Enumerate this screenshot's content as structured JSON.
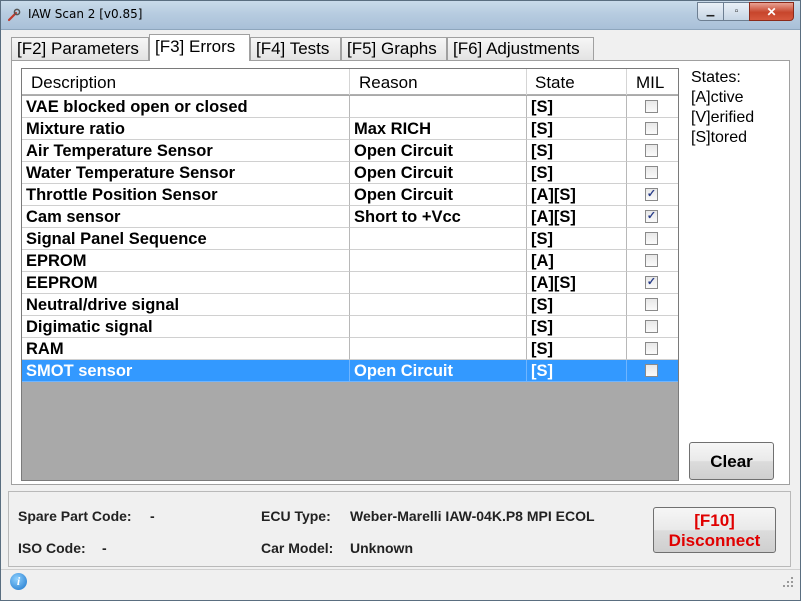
{
  "window": {
    "title": "IAW Scan 2 [v0.85]",
    "close_glyph": "✕",
    "min_glyph": "▁",
    "max_glyph": "▫"
  },
  "tabs": [
    {
      "label": "[F2] Parameters",
      "active": false
    },
    {
      "label": "[F3] Errors",
      "active": true
    },
    {
      "label": "[F4] Tests",
      "active": false
    },
    {
      "label": "[F5] Graphs",
      "active": false
    },
    {
      "label": "[F6] Adjustments",
      "active": false
    }
  ],
  "errors_table": {
    "columns": [
      "Description",
      "Reason",
      "State",
      "MIL"
    ],
    "rows": [
      {
        "description": "VAE blocked open or closed",
        "reason": "",
        "state": "[S]",
        "mil": false,
        "selected": false
      },
      {
        "description": "Mixture ratio",
        "reason": "Max RICH",
        "state": "[S]",
        "mil": false,
        "selected": false
      },
      {
        "description": "Air Temperature Sensor",
        "reason": "Open Circuit",
        "state": "[S]",
        "mil": false,
        "selected": false
      },
      {
        "description": "Water Temperature Sensor",
        "reason": "Open Circuit",
        "state": "[S]",
        "mil": false,
        "selected": false
      },
      {
        "description": "Throttle Position Sensor",
        "reason": "Open Circuit",
        "state": "[A][S]",
        "mil": true,
        "selected": false
      },
      {
        "description": "Cam sensor",
        "reason": "Short to +Vcc",
        "state": "[A][S]",
        "mil": true,
        "selected": false
      },
      {
        "description": "Signal Panel Sequence",
        "reason": "",
        "state": "[S]",
        "mil": false,
        "selected": false
      },
      {
        "description": "EPROM",
        "reason": "",
        "state": "[A]",
        "mil": false,
        "selected": false
      },
      {
        "description": "EEPROM",
        "reason": "",
        "state": "[A][S]",
        "mil": true,
        "selected": false
      },
      {
        "description": "Neutral/drive signal",
        "reason": "",
        "state": "[S]",
        "mil": false,
        "selected": false
      },
      {
        "description": "Digimatic signal",
        "reason": "",
        "state": "[S]",
        "mil": false,
        "selected": false
      },
      {
        "description": "RAM",
        "reason": "",
        "state": "[S]",
        "mil": false,
        "selected": false
      },
      {
        "description": "SMOT sensor",
        "reason": "Open Circuit",
        "state": "[S]",
        "mil": false,
        "selected": true
      }
    ]
  },
  "legend": {
    "title": "States:",
    "items": [
      "[A]ctive",
      "[V]erified",
      "[S]tored"
    ]
  },
  "buttons": {
    "clear": "Clear",
    "disconnect_key": "[F10]",
    "disconnect": "Disconnect"
  },
  "info": {
    "spare_part_label": "Spare Part Code:",
    "spare_part_value": "-",
    "iso_label": "ISO Code:",
    "iso_value": "-",
    "ecu_label": "ECU Type:",
    "ecu_value": "Weber-Marelli IAW-04K.P8 MPI ECOL",
    "car_label": "Car Model:",
    "car_value": "Unknown"
  },
  "colors": {
    "selection": "#3399ff",
    "disconnect_text": "#e00000",
    "grid_empty": "#a9a9a9"
  },
  "icons": {
    "app": "app-wrench-icon",
    "status": "info-icon",
    "grip": "resize-grip-icon"
  }
}
